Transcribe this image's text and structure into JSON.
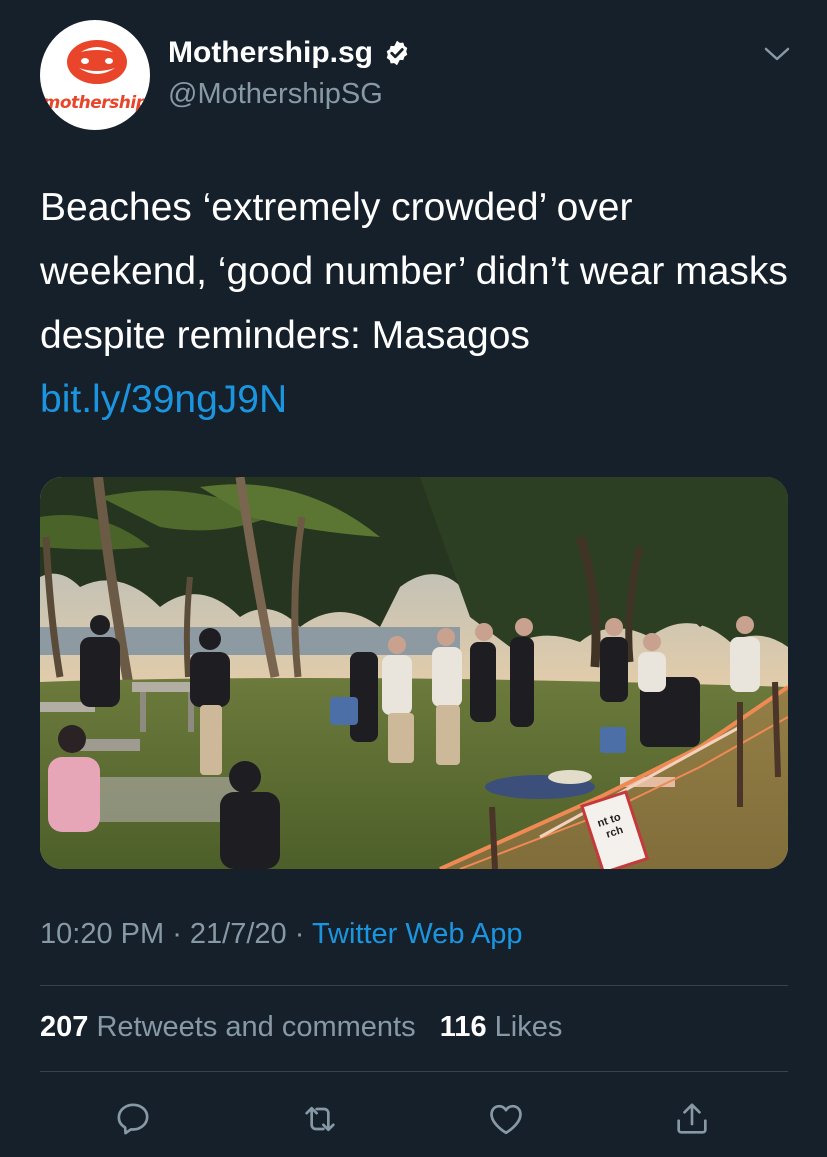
{
  "author": {
    "avatar_text": "mothership",
    "display_name": "Mothership.sg",
    "handle": "@MothershipSG",
    "verified_icon": "verified-badge-icon",
    "brand_color": "#e8452a"
  },
  "menu_icon": "chevron-down-icon",
  "tweet": {
    "text": "Beaches ‘extremely crowded’ over weekend, ‘good number’ didn’t wear masks despite reminders: Masagos",
    "link": "bit.ly/39ngJ9N"
  },
  "photo": {
    "sign_text": "nt to\nrch"
  },
  "meta": {
    "time": "10:20 PM",
    "separator": " · ",
    "date": "21/7/20",
    "source": "Twitter Web App"
  },
  "stats": {
    "retweets_count": "207",
    "retweets_label": "Retweets and comments",
    "likes_count": "116",
    "likes_label": "Likes"
  },
  "actions": [
    {
      "icon": "reply-icon"
    },
    {
      "icon": "retweet-icon"
    },
    {
      "icon": "like-icon"
    },
    {
      "icon": "share-icon"
    }
  ],
  "colors": {
    "background": "#15202b",
    "text": "#ffffff",
    "secondary_text": "#8899a6",
    "link": "#1b95e0",
    "divider": "#38444d"
  }
}
